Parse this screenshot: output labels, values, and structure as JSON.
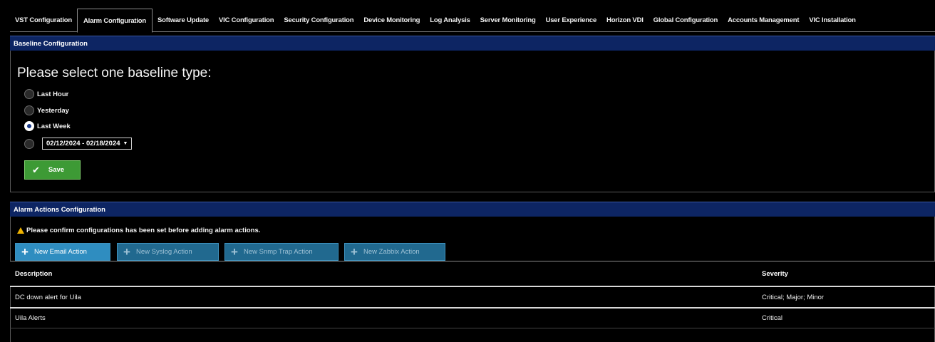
{
  "tabs": [
    {
      "label": "VST Configuration",
      "active": false
    },
    {
      "label": "Alarm Configuration",
      "active": true
    },
    {
      "label": "Software Update",
      "active": false
    },
    {
      "label": "VIC Configuration",
      "active": false
    },
    {
      "label": "Security Configuration",
      "active": false
    },
    {
      "label": "Device Monitoring",
      "active": false
    },
    {
      "label": "Log Analysis",
      "active": false
    },
    {
      "label": "Server Monitoring",
      "active": false
    },
    {
      "label": "User Experience",
      "active": false
    },
    {
      "label": "Horizon VDI",
      "active": false
    },
    {
      "label": "Global Configuration",
      "active": false
    },
    {
      "label": "Accounts Management",
      "active": false
    },
    {
      "label": "VIC Installation",
      "active": false
    }
  ],
  "baseline": {
    "header": "Baseline Configuration",
    "title": "Please select one baseline type:",
    "options": [
      {
        "label": "Last Hour",
        "checked": false
      },
      {
        "label": "Yesterday",
        "checked": false
      },
      {
        "label": "Last Week",
        "checked": true
      }
    ],
    "custom_range": "02/12/2024 - 02/18/2024",
    "save_label": "Save"
  },
  "actions": {
    "header": "Alarm Actions Configuration",
    "warning": "Please confirm configurations has been set before adding alarm actions.",
    "buttons": [
      {
        "label": "New Email Action"
      },
      {
        "label": "New Syslog Action"
      },
      {
        "label": "New Snmp Trap Action"
      },
      {
        "label": "New Zabbix Action"
      }
    ],
    "table": {
      "columns": [
        "Description",
        "Severity"
      ],
      "rows": [
        {
          "description": "DC down alert for Uila",
          "severity": "Critical; Major; Minor"
        },
        {
          "description": "Uila Alerts",
          "severity": "Critical"
        }
      ]
    }
  },
  "colors": {
    "header_bg": "#0d2563",
    "save_green": "#3d9a35",
    "action_blue": "#2f8dc0",
    "warning_yellow": "#f0b400"
  }
}
